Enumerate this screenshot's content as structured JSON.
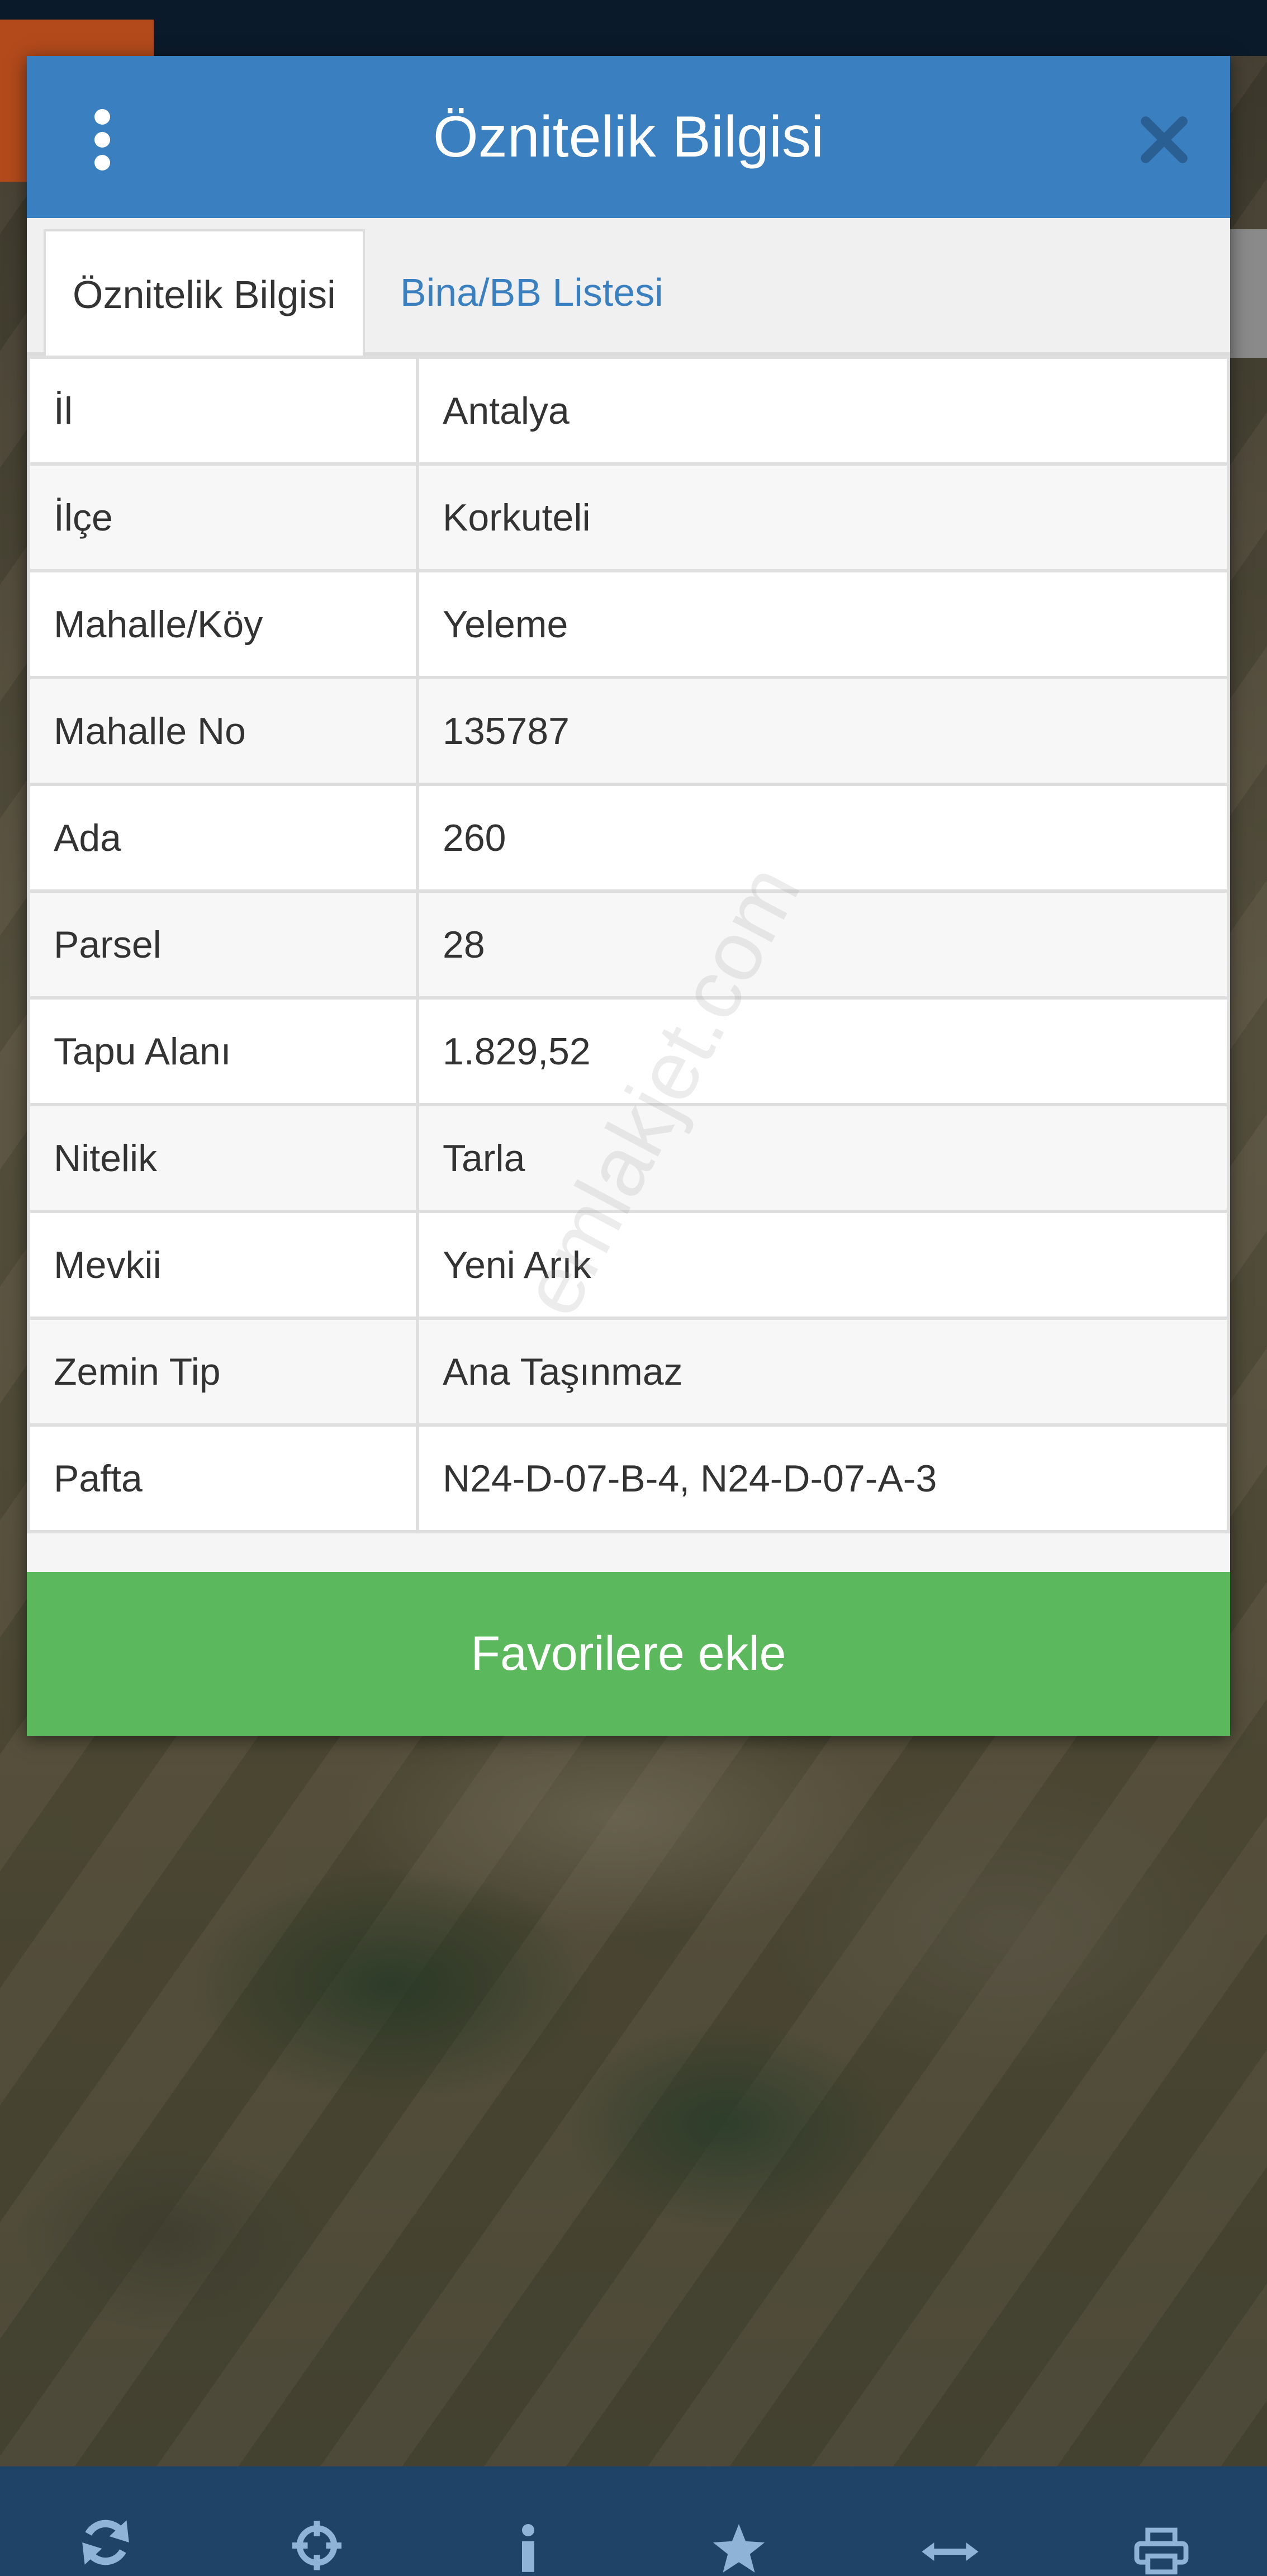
{
  "dialog": {
    "title": "Öznitelik Bilgisi",
    "header_color": "#3a80c1",
    "close_icon": "close-icon",
    "menu_icon": "kebab-menu-icon"
  },
  "tabs": [
    {
      "label": "Öznitelik Bilgisi",
      "active": true
    },
    {
      "label": "Bina/BB Listesi",
      "active": false
    }
  ],
  "attributes": [
    {
      "key": "İl",
      "value": "Antalya"
    },
    {
      "key": "İlçe",
      "value": "Korkuteli"
    },
    {
      "key": "Mahalle/Köy",
      "value": "Yeleme"
    },
    {
      "key": "Mahalle No",
      "value": "135787"
    },
    {
      "key": "Ada",
      "value": "260"
    },
    {
      "key": "Parsel",
      "value": "28"
    },
    {
      "key": "Tapu Alanı",
      "value": "1.829,52"
    },
    {
      "key": "Nitelik",
      "value": "Tarla"
    },
    {
      "key": "Mevkii",
      "value": "Yeni Arık"
    },
    {
      "key": "Zemin Tip",
      "value": "Ana Taşınmaz"
    },
    {
      "key": "Pafta",
      "value": "N24-D-07-B-4, N24-D-07-A-3"
    }
  ],
  "favorite_button": {
    "label": "Favorilere ekle",
    "color": "#5cb85c"
  },
  "watermark": "emlakjet.com",
  "toolbar": {
    "icons": [
      "refresh-icon",
      "locate-crosshair-icon",
      "info-icon",
      "star-icon",
      "measure-arrows-icon",
      "print-icon"
    ],
    "background": "#1f4366"
  }
}
